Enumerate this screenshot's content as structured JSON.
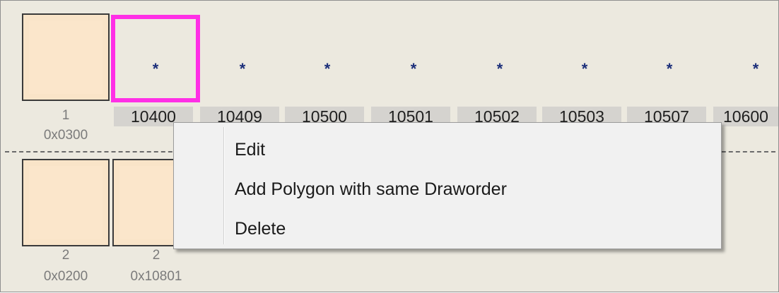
{
  "row1": {
    "tile": {
      "label": "1",
      "address": "0x0300"
    },
    "codes": [
      "10400",
      "10409",
      "10500",
      "10501",
      "10502",
      "10503",
      "10507",
      "10600"
    ],
    "star": "*"
  },
  "row2": {
    "tiles": [
      {
        "label": "2",
        "address": "0x0200"
      },
      {
        "label": "2",
        "address": "0x10801"
      }
    ]
  },
  "context_menu": {
    "items": [
      {
        "label": "Edit"
      },
      {
        "label": "Add  Polygon with same Draworder"
      },
      {
        "label": "Delete"
      }
    ]
  },
  "colors": {
    "selection_border": "#ff2fe6",
    "tile_fill": "#f9e4c8",
    "panel_background": "#ece9df"
  }
}
